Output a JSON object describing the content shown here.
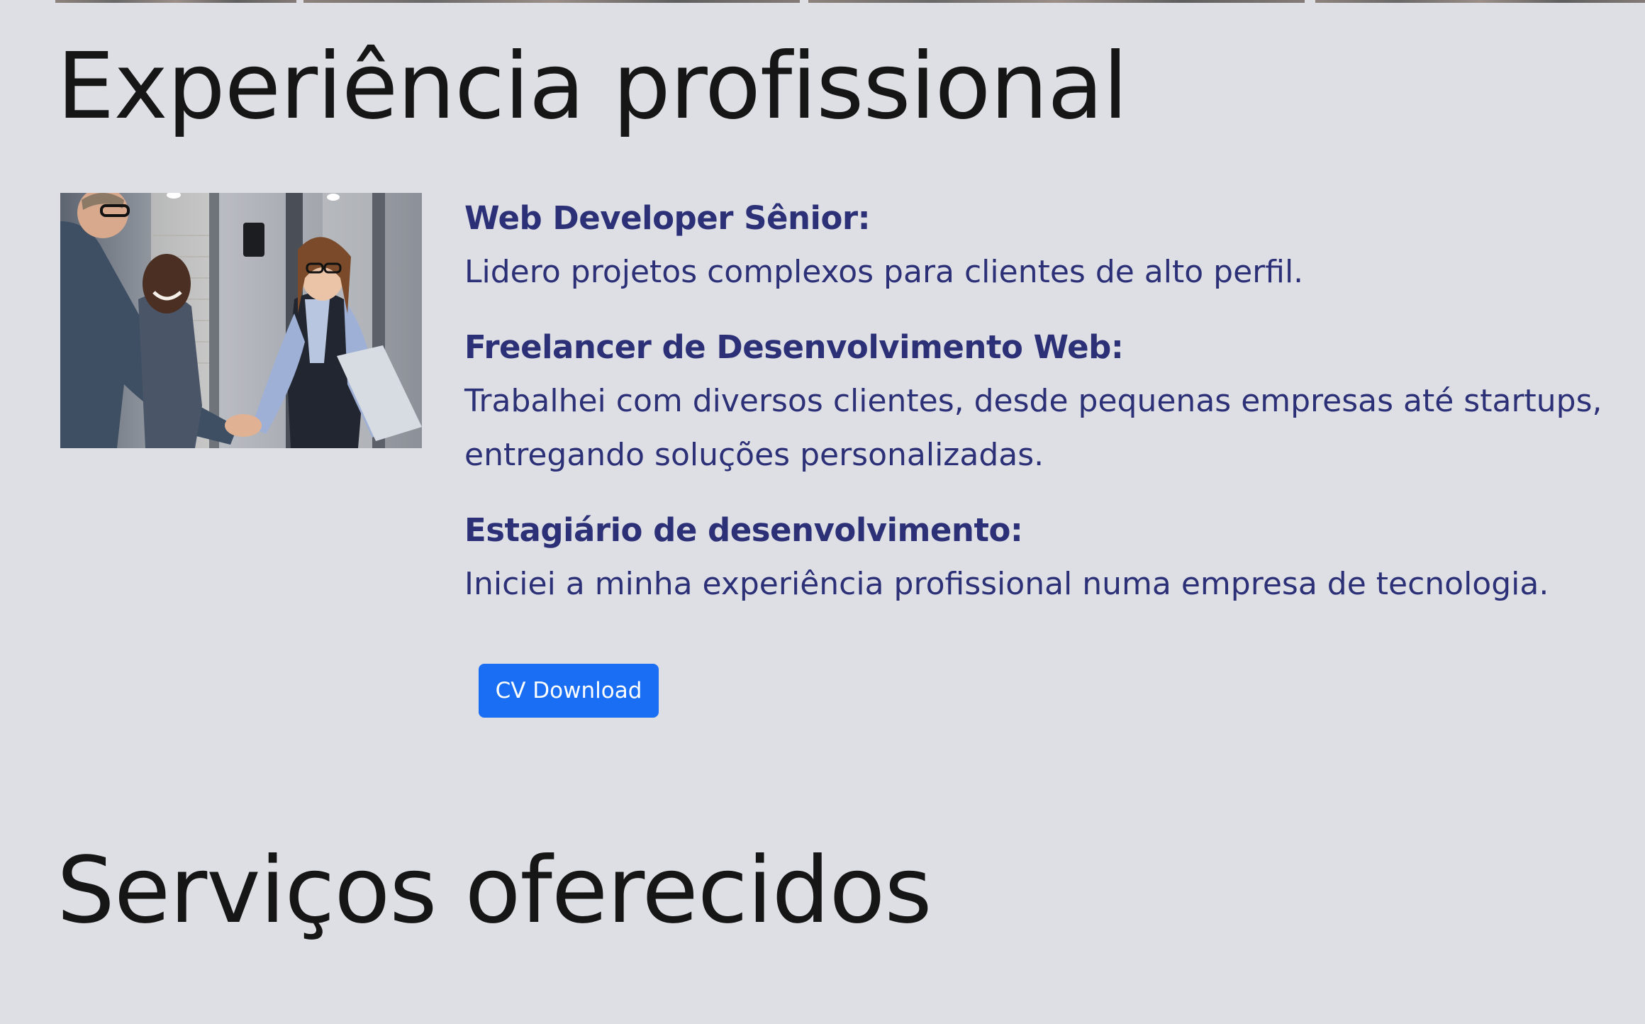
{
  "experience": {
    "title": "Experiência profissional",
    "photo_alt": "Pessoas de negócios apertando as mãos em um escritório",
    "jobs": [
      {
        "title": "Web Developer Sênior:",
        "description": "Lidero projetos complexos para clientes de alto perfil."
      },
      {
        "title": "Freelancer de Desenvolvimento Web:",
        "description": "Trabalhei com diversos clientes, desde pequenas empresas até startups, entregando soluções personalizadas."
      },
      {
        "title": "Estagiário de desenvolvimento:",
        "description": "Iniciei a minha experiência profissional numa empresa de tecnologia."
      }
    ],
    "cv_button_label": "CV Download"
  },
  "services": {
    "title": "Serviços oferecidos"
  },
  "colors": {
    "background": "#dedfe4",
    "heading": "#161616",
    "job_text": "#2c3077",
    "button_bg": "#1a6ef4",
    "button_text": "#ffffff"
  }
}
